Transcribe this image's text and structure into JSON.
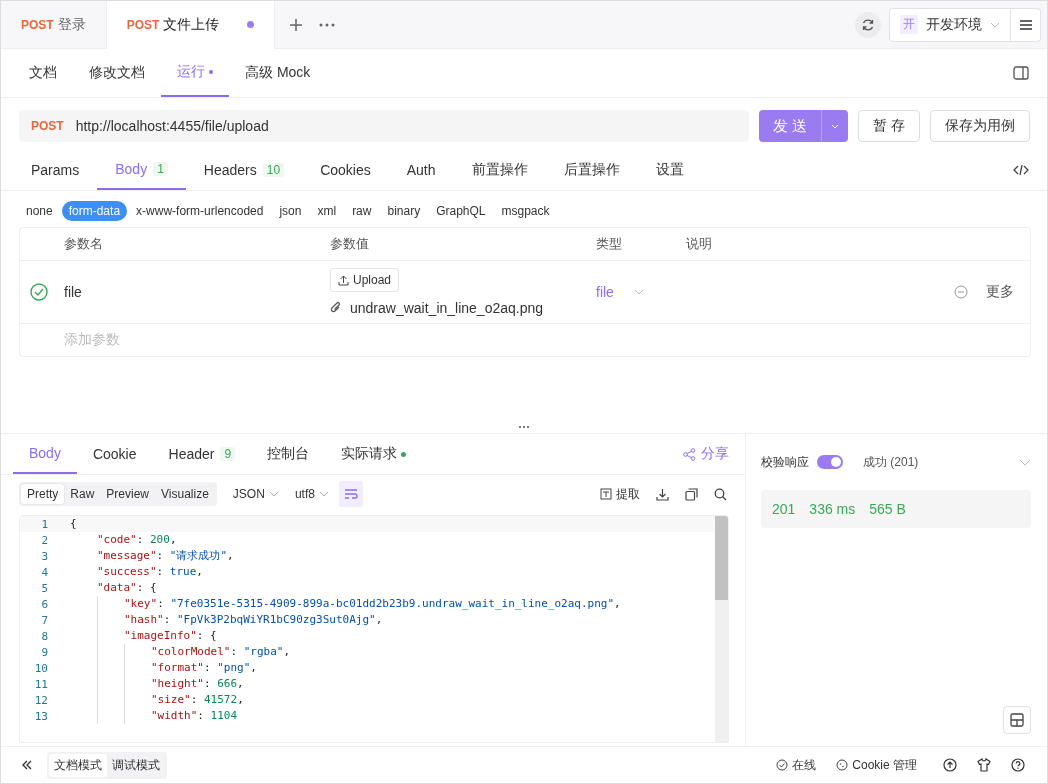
{
  "tabs": [
    {
      "method": "POST",
      "title": "登录",
      "selected": false,
      "modified": false
    },
    {
      "method": "POST",
      "title": "文件上传",
      "selected": true,
      "modified": true
    }
  ],
  "environment": {
    "badge": "开",
    "name": "开发环境"
  },
  "doc_tabs": [
    {
      "label": "文档",
      "selected": false,
      "dot": false
    },
    {
      "label": "修改文档",
      "selected": false,
      "dot": false
    },
    {
      "label": "运行",
      "selected": true,
      "dot": true
    },
    {
      "label": "高级 Mock",
      "selected": false,
      "dot": false
    }
  ],
  "request": {
    "method": "POST",
    "url": "http://localhost:4455/file/upload",
    "send": "发 送",
    "save": "暂 存",
    "save_as": "保存为用例"
  },
  "param_tabs": [
    {
      "label": "Params",
      "selected": false
    },
    {
      "label": "Body",
      "count": "1",
      "selected": true
    },
    {
      "label": "Headers",
      "count": "10",
      "selected": false
    },
    {
      "label": "Cookies",
      "selected": false
    },
    {
      "label": "Auth",
      "selected": false
    },
    {
      "label": "前置操作",
      "selected": false
    },
    {
      "label": "后置操作",
      "selected": false
    },
    {
      "label": "设置",
      "selected": false
    }
  ],
  "body_types": [
    {
      "label": "none",
      "selected": false
    },
    {
      "label": "form-data",
      "selected": true
    },
    {
      "label": "x-www-form-urlencoded",
      "selected": false
    },
    {
      "label": "json",
      "selected": false
    },
    {
      "label": "xml",
      "selected": false
    },
    {
      "label": "raw",
      "selected": false
    },
    {
      "label": "binary",
      "selected": false
    },
    {
      "label": "GraphQL",
      "selected": false
    },
    {
      "label": "msgpack",
      "selected": false
    }
  ],
  "params_table": {
    "columns": [
      "参数名",
      "参数值",
      "类型",
      "说明"
    ],
    "rows": [
      {
        "enabled": true,
        "name": "file",
        "upload": "Upload",
        "file_name": "undraw_wait_in_line_o2aq.png",
        "type": "file",
        "more": "更多"
      }
    ],
    "add_placeholder": "添加参数"
  },
  "response": {
    "tabs": [
      {
        "label": "Body",
        "selected": true,
        "dot": false
      },
      {
        "label": "Cookie",
        "selected": false,
        "dot": false
      },
      {
        "label": "Header",
        "count": "9",
        "selected": false,
        "dot": false
      },
      {
        "label": "控制台",
        "selected": false,
        "dot": false
      },
      {
        "label": "实际请求",
        "selected": false,
        "dot": true
      }
    ],
    "share": "分享",
    "view_modes": [
      {
        "label": "Pretty",
        "selected": true
      },
      {
        "label": "Raw",
        "selected": false
      },
      {
        "label": "Preview",
        "selected": false
      },
      {
        "label": "Visualize",
        "selected": false
      }
    ],
    "format": "JSON",
    "encoding": "utf8",
    "extract": "提取",
    "code": [
      {
        "number": "1",
        "tokens": [
          {
            "kind": "punct",
            "text": "{"
          }
        ],
        "children": [
          {
            "number": "2",
            "tokens": [
              {
                "kind": "key",
                "text": "\"code\""
              },
              {
                "kind": "punct",
                "text": ": "
              },
              {
                "kind": "number",
                "text": "200"
              },
              {
                "kind": "punct",
                "text": ","
              }
            ]
          },
          {
            "number": "3",
            "tokens": [
              {
                "kind": "key",
                "text": "\"message\""
              },
              {
                "kind": "punct",
                "text": ": "
              },
              {
                "kind": "string",
                "text": "\"请求成功\""
              },
              {
                "kind": "punct",
                "text": ","
              }
            ]
          },
          {
            "number": "4",
            "tokens": [
              {
                "kind": "key",
                "text": "\"success\""
              },
              {
                "kind": "punct",
                "text": ": "
              },
              {
                "kind": "bool",
                "text": "true"
              },
              {
                "kind": "punct",
                "text": ","
              }
            ]
          },
          {
            "number": "5",
            "tokens": [
              {
                "kind": "key",
                "text": "\"data\""
              },
              {
                "kind": "punct",
                "text": ": {"
              }
            ],
            "children": [
              {
                "number": "6",
                "tokens": [
                  {
                    "kind": "key",
                    "text": "\"key\""
                  },
                  {
                    "kind": "punct",
                    "text": ": "
                  },
                  {
                    "kind": "string",
                    "text": "\"7fe0351e-5315-4909-899a-bc01dd2b23b9.undraw_wait_in_line_o2aq.png\""
                  },
                  {
                    "kind": "punct",
                    "text": ","
                  }
                ]
              },
              {
                "number": "7",
                "tokens": [
                  {
                    "kind": "key",
                    "text": "\"hash\""
                  },
                  {
                    "kind": "punct",
                    "text": ": "
                  },
                  {
                    "kind": "string",
                    "text": "\"FpVk3P2bqWiYR1bC90zg3Sut0Ajg\""
                  },
                  {
                    "kind": "punct",
                    "text": ","
                  }
                ]
              },
              {
                "number": "8",
                "tokens": [
                  {
                    "kind": "key",
                    "text": "\"imageInfo\""
                  },
                  {
                    "kind": "punct",
                    "text": ": {"
                  }
                ],
                "children": [
                  {
                    "number": "9",
                    "tokens": [
                      {
                        "kind": "key",
                        "text": "\"colorModel\""
                      },
                      {
                        "kind": "punct",
                        "text": ": "
                      },
                      {
                        "kind": "string",
                        "text": "\"rgba\""
                      },
                      {
                        "kind": "punct",
                        "text": ","
                      }
                    ]
                  },
                  {
                    "number": "10",
                    "tokens": [
                      {
                        "kind": "key",
                        "text": "\"format\""
                      },
                      {
                        "kind": "punct",
                        "text": ": "
                      },
                      {
                        "kind": "string",
                        "text": "\"png\""
                      },
                      {
                        "kind": "punct",
                        "text": ","
                      }
                    ]
                  },
                  {
                    "number": "11",
                    "tokens": [
                      {
                        "kind": "key",
                        "text": "\"height\""
                      },
                      {
                        "kind": "punct",
                        "text": ": "
                      },
                      {
                        "kind": "number",
                        "text": "666"
                      },
                      {
                        "kind": "punct",
                        "text": ","
                      }
                    ]
                  },
                  {
                    "number": "12",
                    "tokens": [
                      {
                        "kind": "key",
                        "text": "\"size\""
                      },
                      {
                        "kind": "punct",
                        "text": ": "
                      },
                      {
                        "kind": "number",
                        "text": "41572"
                      },
                      {
                        "kind": "punct",
                        "text": ","
                      }
                    ]
                  },
                  {
                    "number": "13",
                    "tokens": [
                      {
                        "kind": "key",
                        "text": "\"width\""
                      },
                      {
                        "kind": "punct",
                        "text": ": "
                      },
                      {
                        "kind": "number",
                        "text": "1104"
                      }
                    ]
                  }
                ]
              }
            ]
          }
        ]
      }
    ]
  },
  "validation": {
    "label": "校验响应",
    "on": true,
    "result": "成功 (201)",
    "status": "201",
    "time": "336 ms",
    "size": "565 B"
  },
  "footer": {
    "modes": [
      {
        "label": "文档模式",
        "selected": true
      },
      {
        "label": "调试模式",
        "selected": false
      }
    ],
    "online": "在线",
    "cookie": "Cookie 管理"
  }
}
